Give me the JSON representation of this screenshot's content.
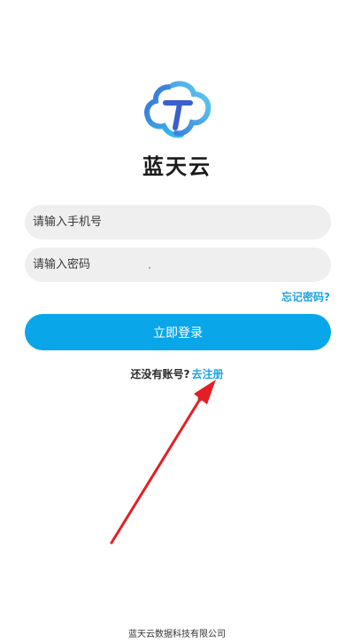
{
  "brand": {
    "name": "蓝天云",
    "logo_icon": "cloud-t-logo-icon",
    "colors": {
      "logo_gradient_start": "#3b6fd8",
      "logo_gradient_end": "#36c4e6"
    }
  },
  "form": {
    "phone_placeholder": "请输入手机号",
    "password_placeholder": "请输入密码",
    "forgot_label": "忘记密码?",
    "login_label": "立即登录"
  },
  "register": {
    "prompt": "还没有账号?",
    "link": "去注册"
  },
  "annotation": {
    "arrow_color": "#e31f26",
    "arrow_icon": "red-arrow-pointer-icon"
  },
  "footer": {
    "company": "蓝天云数据科技有限公司"
  },
  "theme": {
    "accent": "#0aa6ea",
    "link": "#1aa3e8",
    "input_bg": "#efefef"
  }
}
